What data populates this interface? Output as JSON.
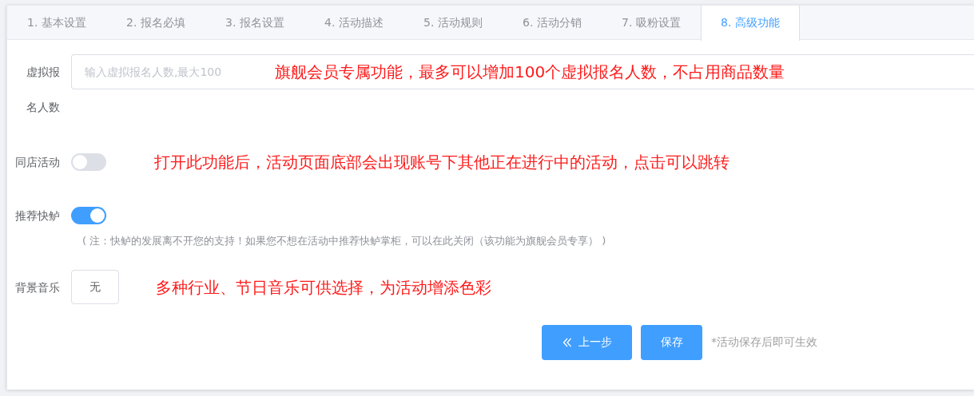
{
  "tabs": [
    {
      "label": "1. 基本设置",
      "selected": false
    },
    {
      "label": "2. 报名必填",
      "selected": false
    },
    {
      "label": "3. 报名设置",
      "selected": false
    },
    {
      "label": "4. 活动描述",
      "selected": false
    },
    {
      "label": "5. 活动规则",
      "selected": false
    },
    {
      "label": "6. 活动分销",
      "selected": false
    },
    {
      "label": "7. 吸粉设置",
      "selected": false
    },
    {
      "label": "8. 高级功能",
      "selected": true
    }
  ],
  "form": {
    "rows": [
      {
        "kind": "input",
        "label": "虚拟报名人数",
        "placeholder": "输入虚拟报名人数,最大100",
        "annotation": "旗舰会员专属功能，最多可以增加100个虚拟报名人数，不占用商品数量"
      },
      {
        "kind": "switch",
        "label": "同店活动",
        "on": false,
        "annotation": "打开此功能后，活动页面底部会出现账号下其他正在进行中的活动，点击可以跳转"
      },
      {
        "kind": "switch",
        "label": "推荐快鲈",
        "on": true,
        "note": "( 注：快鲈的发展离不开您的支持！如果您不想在活动中推荐快鲈掌柜，可以在此关闭（该功能为旗舰会员专享） )"
      },
      {
        "kind": "select",
        "label": "背景音乐",
        "value": "无",
        "annotation": "多种行业、节日音乐可供选择，为活动增添色彩"
      }
    ]
  },
  "actions": {
    "buttons": [
      {
        "kind": "back",
        "label": "上一步"
      },
      {
        "kind": "save",
        "label": "保存"
      }
    ],
    "hint": "*活动保存后即可生效"
  }
}
